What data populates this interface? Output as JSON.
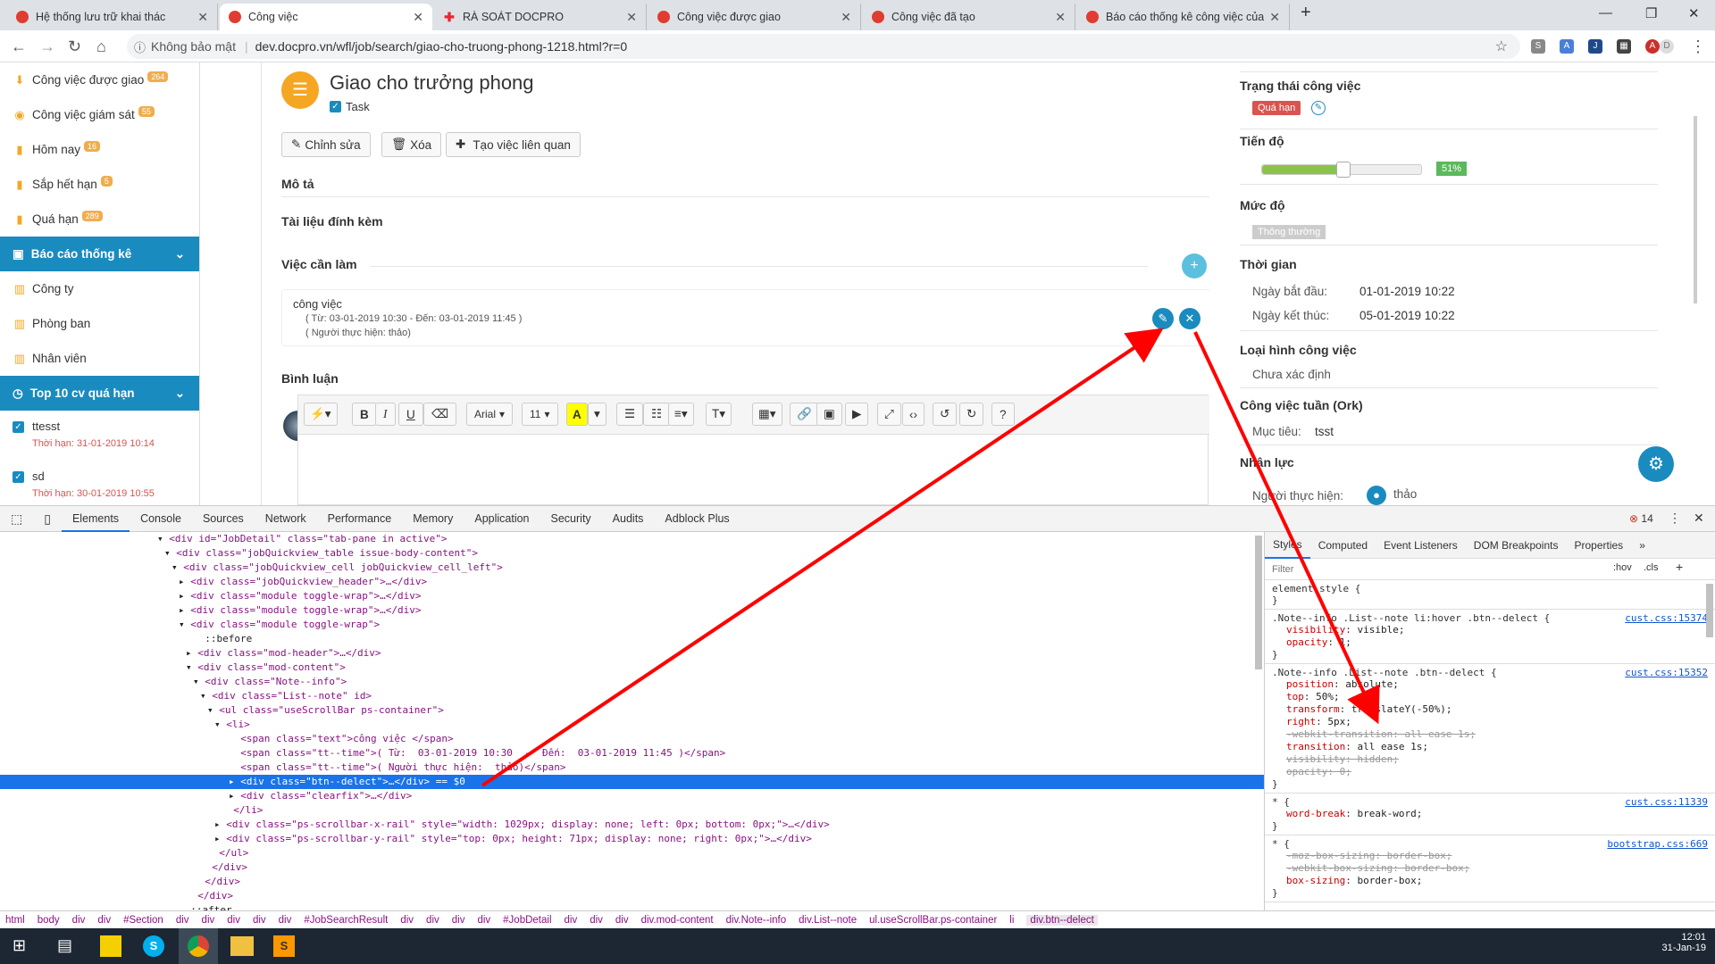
{
  "browser": {
    "tabs": [
      {
        "title": "Hệ thống lưu trữ khai thác",
        "active": false
      },
      {
        "title": "Công việc",
        "active": true
      },
      {
        "title": "RÀ SOÁT DOCPRO",
        "active": false
      },
      {
        "title": "Công việc được giao",
        "active": false
      },
      {
        "title": "Công việc đã tạo",
        "active": false
      },
      {
        "title": "Báo cáo thống kê công việc của",
        "active": false
      }
    ],
    "security": "Không bảo mật",
    "url": "dev.docpro.vn/wfl/job/search/giao-cho-truong-phong-1218.html?r=0"
  },
  "sidebar": {
    "items": [
      {
        "label": "Công việc được giao",
        "badge": "264",
        "icon": "arrow-down-icon"
      },
      {
        "label": "Công việc giám sát",
        "badge": "55",
        "icon": "eye-icon"
      },
      {
        "label": "Hôm nay",
        "badge": "16",
        "icon": "bookmark-icon"
      },
      {
        "label": "Sắp hết hạn",
        "badge": "5",
        "icon": "bookmark-icon"
      },
      {
        "label": "Quá hạn",
        "badge": "289",
        "icon": "bookmark-icon"
      }
    ],
    "report_header": "Báo cáo thống kê",
    "report_items": [
      "Công ty",
      "Phòng ban",
      "Nhân viên"
    ],
    "top10_header": "Top 10 cv quá hạn",
    "tasks": [
      {
        "name": "ttesst",
        "deadline": "Thời hạn: 31-01-2019 10:14"
      },
      {
        "name": "sd",
        "deadline": "Thời hạn: 30-01-2019 10:55"
      }
    ]
  },
  "job": {
    "title": "Giao cho trưởng phong",
    "type": "Task",
    "buttons": {
      "edit": "Chỉnh sửa",
      "delete": "Xóa",
      "create_related": "Tạo việc liên quan"
    },
    "sections": {
      "description": "Mô tả",
      "attachments": "Tài liệu đính kèm",
      "todo": "Việc cần làm",
      "comments": "Bình luận"
    },
    "todo_item": {
      "text": "công việc",
      "time": "( Từ: 03-01-2019 10:30 - Đến: 03-01-2019 11:45 )",
      "assignee": "( Người thực hiện: thảo)"
    },
    "editor": {
      "font": "Arial",
      "size": "11"
    }
  },
  "details": {
    "status_label": "Trạng thái công việc",
    "status": "Quá hạn",
    "progress_label": "Tiến độ",
    "progress": "51%",
    "progress_value": 51,
    "priority_label": "Mức độ",
    "priority": "Thông thường",
    "time_label": "Thời gian",
    "start_label": "Ngày bắt đầu:",
    "start": "01-01-2019 10:22",
    "end_label": "Ngày kết thúc:",
    "end": "05-01-2019 10:22",
    "kind_label": "Loại hình công việc",
    "kind": "Chưa xác định",
    "week_label": "Công việc tuần (Ork)",
    "target_label": "Mục tiêu:",
    "target": "tsst",
    "staff_label": "Nhân lực",
    "assignee_label": "Người thực hiện:",
    "assignee": "thảo"
  },
  "devtools": {
    "tabs": [
      "Elements",
      "Console",
      "Sources",
      "Network",
      "Performance",
      "Memory",
      "Application",
      "Security",
      "Audits",
      "Adblock Plus"
    ],
    "error_count": "14",
    "dom_lines": [
      "<div id=\"JobDetail\" class=\"tab-pane in active\">",
      "<div class=\"jobQuickview_table issue-body-content\">",
      "<div class=\"jobQuickview_cell jobQuickview_cell_left\">",
      "<div class=\"jobQuickview_header\">…</div>",
      "<div class=\"module toggle-wrap\">…</div>",
      "<div class=\"module toggle-wrap\">…</div>",
      "<div class=\"module toggle-wrap\">",
      "::before",
      "<div class=\"mod-header\">…</div>",
      "<div class=\"mod-content\">",
      "<div class=\"Note--info\">",
      "<div class=\"List--note\" id>",
      "<ul class=\"useScrollBar ps-container\">",
      "<li>",
      "<span class=\"text\">công việc </span>",
      "<span class=\"tt--time\">( Từ:  03-01-2019 10:30  -  Đến:  03-01-2019 11:45 )</span>",
      "<span class=\"tt--time\">( Người thực hiện:  thảo)</span>",
      "<div class=\"btn--delect\">…</div> == $0",
      "<div class=\"clearfix\">…</div>",
      "</li>",
      "<div class=\"ps-scrollbar-x-rail\" style=\"width: 1029px; display: none; left: 0px; bottom: 0px;\">…</div>",
      "<div class=\"ps-scrollbar-y-rail\" style=\"top: 0px; height: 71px; display: none; right: 0px;\">…</div>",
      "</ul>",
      "</div>",
      "</div>",
      "</div>",
      "::after"
    ],
    "styles_tabs": [
      "Styles",
      "Computed",
      "Event Listeners",
      "DOM Breakpoints",
      "Properties"
    ],
    "filter_placeholder": "Filter",
    "hov": ":hov",
    "cls": ".cls",
    "rules": [
      {
        "selector": "element.style {",
        "source": "",
        "props": []
      },
      {
        "selector": ".Note--info .List--note li:hover .btn--delect {",
        "source": "cust.css:15374",
        "props": [
          {
            "n": "visibility",
            "v": "visible;",
            "s": false
          },
          {
            "n": "opacity",
            "v": "1;",
            "s": false
          }
        ]
      },
      {
        "selector": ".Note--info .List--note .btn--delect {",
        "source": "cust.css:15352",
        "props": [
          {
            "n": "position",
            "v": "absolute;",
            "s": false
          },
          {
            "n": "top",
            "v": "50%;",
            "s": false
          },
          {
            "n": "transform",
            "v": "translateY(-50%);",
            "s": false
          },
          {
            "n": "right",
            "v": "5px;",
            "s": false
          },
          {
            "n": "-webkit-transition",
            "v": "all ease 1s;",
            "s": true
          },
          {
            "n": "transition",
            "v": "all ease 1s;",
            "s": false
          },
          {
            "n": "visibility",
            "v": "hidden;",
            "s": true
          },
          {
            "n": "opacity",
            "v": "0;",
            "s": true
          }
        ]
      },
      {
        "selector": "* {",
        "source": "cust.css:11339",
        "props": [
          {
            "n": "word-break",
            "v": "break-word;",
            "s": false
          }
        ]
      },
      {
        "selector": "* {",
        "source": "bootstrap.css:669",
        "props": [
          {
            "n": "-moz-box-sizing",
            "v": "border-box;",
            "s": true
          },
          {
            "n": "-webkit-box-sizing",
            "v": "border-box;",
            "s": true
          },
          {
            "n": "box-sizing",
            "v": "border-box;",
            "s": false
          }
        ]
      }
    ],
    "breadcrumbs": [
      "html",
      "body",
      "div",
      "div",
      "#Section",
      "div",
      "div",
      "div",
      "div",
      "div",
      "#JobSearchResult",
      "div",
      "div",
      "div",
      "div",
      "#JobDetail",
      "div",
      "div",
      "div",
      "div.mod-content",
      "div.Note--info",
      "div.List--note",
      "ul.useScrollBar.ps-container",
      "li",
      "div.btn--delect"
    ]
  },
  "taskbar": {
    "time": "12:01",
    "date": "31-Jan-19"
  },
  "colors": {
    "accent": "#1a8bbf",
    "danger": "#d9534f",
    "success": "#5cb85c",
    "annotation": "#ff0000"
  }
}
